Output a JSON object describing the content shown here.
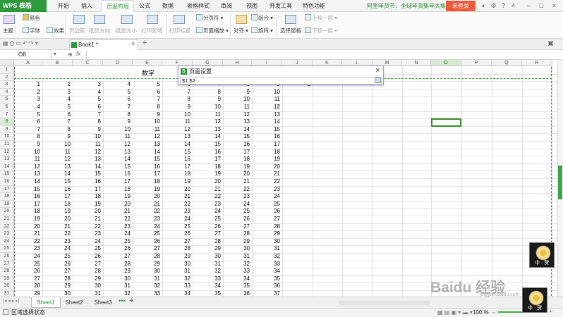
{
  "app": {
    "logo": "WPS 表格"
  },
  "menu_tabs": [
    "开始",
    "插入",
    "页面布局",
    "公式",
    "数据",
    "表格样式",
    "审阅",
    "视图",
    "开发工具",
    "特色功能"
  ],
  "active_menu_tab": "页面布局",
  "promo": "阿里年货节，全球年货集年大集",
  "login_label": "未登录",
  "ribbon": {
    "theme": "主题",
    "colors": "颜色",
    "fonts": "字体",
    "effects": "效果",
    "margins": "页边距",
    "orientation": "纸张方向",
    "size": "纸张大小",
    "print_area": "打印区域",
    "print_titles": "打印标题",
    "page_break": "分页符",
    "page_zoom": "页面缩放",
    "align": "对齐",
    "group": "组合",
    "rotate": "旋转",
    "selection_pane": "选择窗格",
    "bring_forward": "上移一层",
    "send_backward": "下移一层"
  },
  "document_tab": "Book1 *",
  "name_box": "O8",
  "fx_label": "fx",
  "columns": [
    "A",
    "B",
    "C",
    "D",
    "E",
    "F",
    "G",
    "H",
    "I",
    "J",
    "K",
    "L",
    "M",
    "N",
    "O",
    "P",
    "Q",
    "R"
  ],
  "selected_column": "O",
  "rows": [
    "1",
    "2",
    "3",
    "4",
    "5",
    "6",
    "7",
    "8",
    "9",
    "10",
    "11",
    "12",
    "13",
    "14",
    "15",
    "16",
    "17",
    "18",
    "19",
    "20",
    "21",
    "22",
    "23",
    "24",
    "25",
    "26",
    "27",
    "28",
    "29",
    "30",
    "31"
  ],
  "selected_row": "8",
  "header_text": "数字",
  "j3_value": "1",
  "dialog": {
    "icon": "S",
    "title": "页面设置",
    "input_value": "$1:$2",
    "close": "×"
  },
  "sheets": [
    "Sheet1",
    "Sheet2",
    "Sheet3"
  ],
  "active_sheet": "Sheet1",
  "status_text": "区域选择状态",
  "zoom": "100 %",
  "watermark": {
    "text": "Baidu 经验",
    "sub": "jingyan.baidu.com"
  },
  "stamp_text": "中 · 贺",
  "colors": {
    "accent": "#2e9a3c",
    "login": "#ef5a3c",
    "selection": "#3f8f2f",
    "dialog_border": "#a99dc8"
  }
}
